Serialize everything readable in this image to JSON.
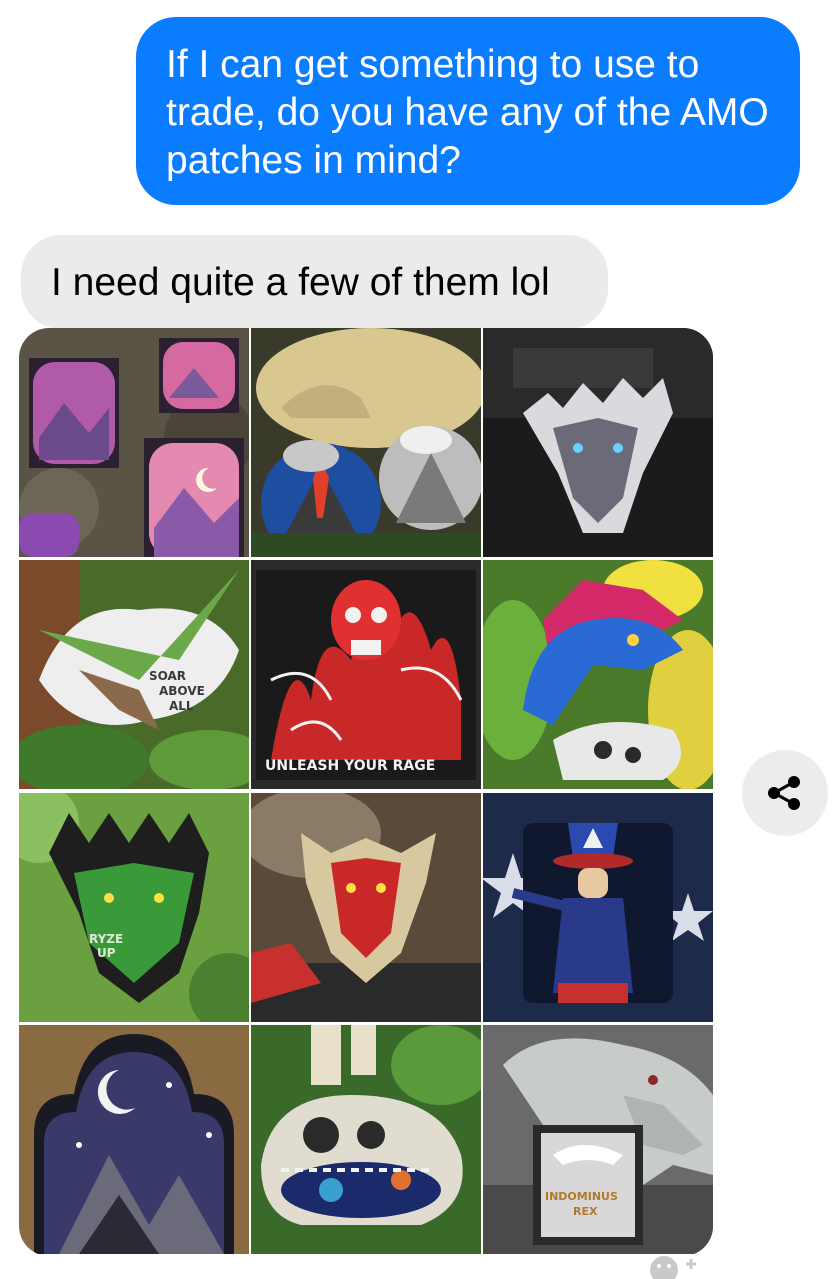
{
  "messages": [
    {
      "direction": "outgoing",
      "text": "If I can get something to use to trade, do you have any of the AMO patches in mind?"
    },
    {
      "direction": "incoming",
      "text": "I need quite a few of them lol"
    }
  ],
  "gallery": {
    "photos": [
      {
        "subject": "Purple paw patches with mountains and moon"
      },
      {
        "subject": "Volcano patches with dinosaur skull"
      },
      {
        "subject": "Dragon head patch on black fabric"
      },
      {
        "subject": "Pterodactyl patch",
        "lettering": "SOAR ABOVE ALL"
      },
      {
        "subject": "Red flaming skull patch",
        "lettering": "UNLEASH YOUR RAGE"
      },
      {
        "subject": "Blue raptor with jungle leaves patch"
      },
      {
        "subject": "Green dragon head patch in tree",
        "lettering": "RYZE UP"
      },
      {
        "subject": "Red dragon head patch on rock"
      },
      {
        "subject": "Uncle Sam style patch with stars"
      },
      {
        "subject": "Night mountain paw patch with crescent moon"
      },
      {
        "subject": "Dinosaur skull space patch"
      },
      {
        "subject": "Indominus rex figure with patch",
        "lettering": "INDOMINUS REX"
      }
    ]
  },
  "share_icon": "share-icon",
  "reaction_icon": "add-reaction-icon",
  "colors": {
    "outgoing_bubble": "#0a7cff",
    "incoming_bubble": "#ebebeb",
    "share_button_bg": "#ececec"
  }
}
